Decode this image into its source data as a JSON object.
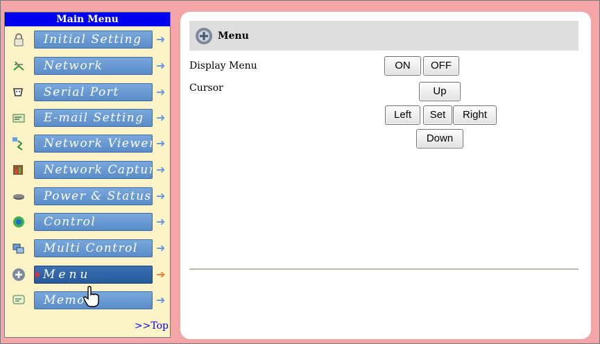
{
  "sidebar": {
    "title": "Main Menu",
    "items": [
      {
        "label": "Initial Setting",
        "icon": "lock-icon",
        "active": false
      },
      {
        "label": "Network",
        "icon": "network-icon",
        "active": false
      },
      {
        "label": "Serial Port",
        "icon": "serial-port-icon",
        "active": false
      },
      {
        "label": "E-mail Setting",
        "icon": "email-icon",
        "active": false
      },
      {
        "label": "Network Viewer",
        "icon": "network-viewer-icon",
        "active": false
      },
      {
        "label": "Network Capture",
        "icon": "network-capture-icon",
        "active": false
      },
      {
        "label": "Power & Status",
        "icon": "power-status-icon",
        "active": false
      },
      {
        "label": "Control",
        "icon": "control-icon",
        "active": false
      },
      {
        "label": "Multi Control",
        "icon": "multi-control-icon",
        "active": false
      },
      {
        "label": "Menu",
        "icon": "menu-icon",
        "active": true
      },
      {
        "label": "Memo",
        "icon": "memo-icon",
        "active": false
      }
    ],
    "arrow_glyph": "➜",
    "top_link": ">>Top"
  },
  "main": {
    "section_title": "Menu",
    "display_menu": {
      "label": "Display Menu",
      "on_label": "ON",
      "off_label": "OFF"
    },
    "cursor": {
      "label": "Cursor",
      "up_label": "Up",
      "left_label": "Left",
      "set_label": "Set",
      "right_label": "Right",
      "down_label": "Down"
    }
  },
  "colors": {
    "background": "#f4a5a8",
    "sidebar_bg": "#fdf3c9",
    "sidebar_title_bg": "#0000ee",
    "menu_button": "#6b9bd6",
    "menu_button_active": "#2f63a8",
    "active_arrow": "#f08030"
  }
}
